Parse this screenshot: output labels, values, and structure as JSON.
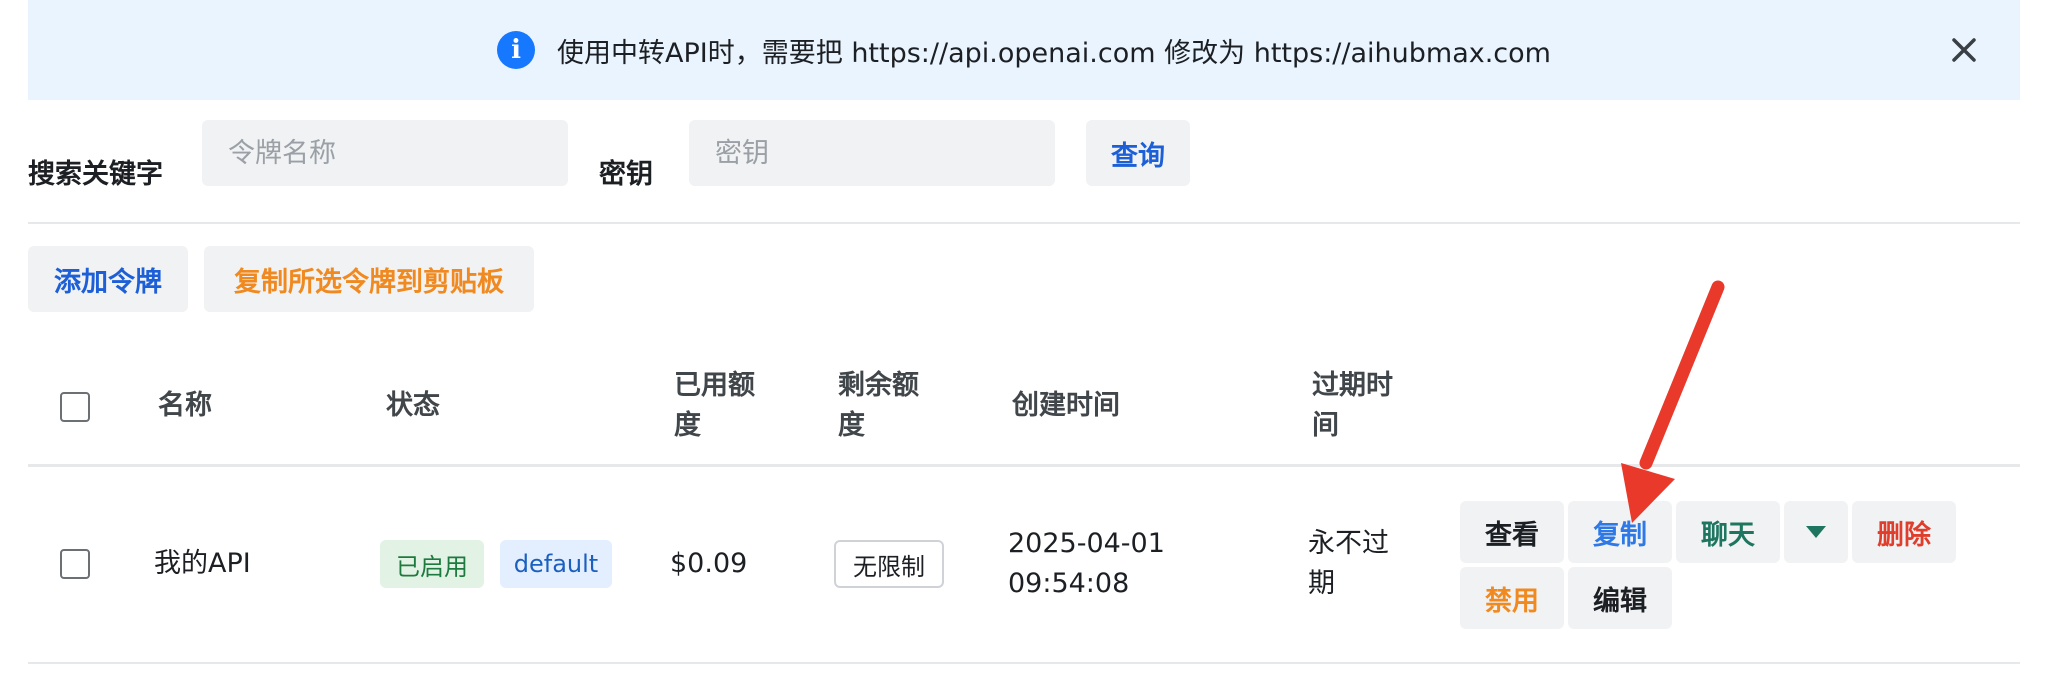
{
  "banner": {
    "message": "使用中转API时，需要把 https://api.openai.com 修改为 https://aihubmax.com",
    "icon": "info-icon",
    "close_icon": "close-icon"
  },
  "search": {
    "keyword_label": "搜索关键字",
    "keyword_placeholder": "令牌名称",
    "key_label": "密钥",
    "key_placeholder": "密钥",
    "query_button": "查询"
  },
  "toolbar": {
    "add_token": "添加令牌",
    "copy_selected": "复制所选令牌到剪贴板"
  },
  "table": {
    "headers": {
      "name": "名称",
      "status": "状态",
      "used_quota_line1": "已用额",
      "used_quota_line2": "度",
      "remaining_line1": "剩余额",
      "remaining_line2": "度",
      "created": "创建时间",
      "expire_line1": "过期时",
      "expire_line2": "间"
    },
    "rows": [
      {
        "name": "我的API",
        "status": "已启用",
        "group": "default",
        "used": "$0.09",
        "remaining": "无限制",
        "created_date": "2025-04-01",
        "created_time": "09:54:08",
        "expire_line1": "永不过",
        "expire_line2": "期",
        "actions": {
          "view": "查看",
          "copy": "复制",
          "chat": "聊天",
          "delete": "删除",
          "disable": "禁用",
          "edit": "编辑"
        }
      }
    ]
  },
  "colors": {
    "accent_blue": "#1d5fd6",
    "orange": "#f0891f",
    "teal": "#1e7661",
    "red": "#e03e2d",
    "arrow": "#e8392b"
  }
}
